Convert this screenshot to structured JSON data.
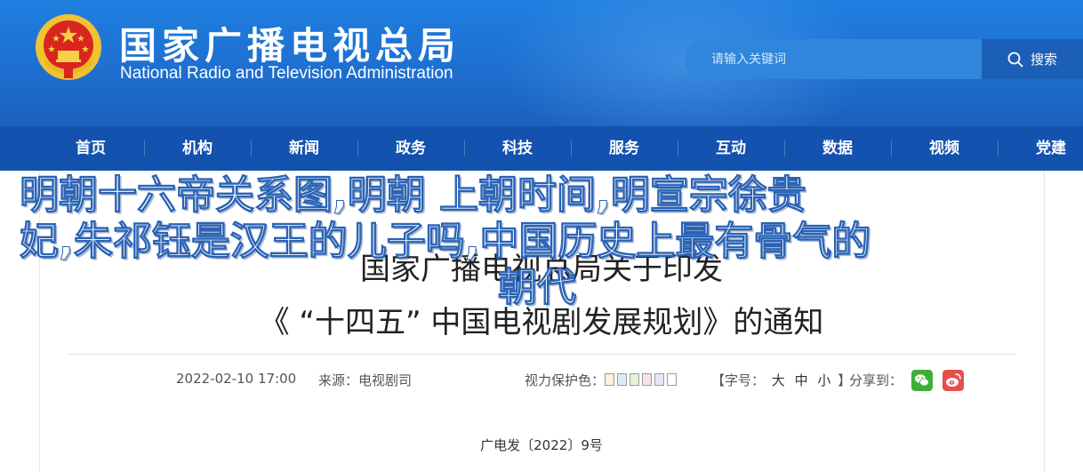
{
  "header": {
    "title_cn": "国家广播电视总局",
    "title_en": "National Radio and Television Administration",
    "emblem": "national-emblem"
  },
  "search": {
    "placeholder": "请输入关键词",
    "button_label": "搜索",
    "icon": "search-icon"
  },
  "nav": {
    "items": [
      {
        "label": "首页"
      },
      {
        "label": "机构"
      },
      {
        "label": "新闻"
      },
      {
        "label": "政务"
      },
      {
        "label": "科技"
      },
      {
        "label": "服务"
      },
      {
        "label": "互动"
      },
      {
        "label": "数据"
      },
      {
        "label": "视频"
      },
      {
        "label": "党建"
      }
    ]
  },
  "article": {
    "title_line1": "国家广播电视总局关于印发",
    "title_line2": "《 “十四五” 中国电视剧发展规划》的通知",
    "date": "2022-02-10 17:00",
    "source": "来源：电视剧司",
    "eye_care_label": "视力保护色：",
    "eye_care_colors": [
      "#fbf3d3",
      "#d9ecf8",
      "#e6f0da",
      "#f6e3ec",
      "#ece4f6",
      "#ffffff"
    ],
    "font_size_label": "【字号：",
    "font_size_options": [
      "大",
      "中",
      "小"
    ],
    "font_size_close": "】",
    "share_label": "分享到：",
    "share_icons": [
      "wechat-icon",
      "weibo-icon"
    ],
    "doc_number": "广电发〔2022〕9号"
  },
  "overlay": {
    "line1": "明朝十六帝关系图,明朝  上朝时间,明宣宗徐贵",
    "line2": "妃,朱祁钰是汉王的儿子吗,中国历史上最有骨气的",
    "line3": "朝代"
  },
  "colors": {
    "header_blue": "#1e6fd0",
    "nav_blue": "#1452b0",
    "wechat_green": "#3cb034",
    "weibo_red": "#e6504a"
  }
}
